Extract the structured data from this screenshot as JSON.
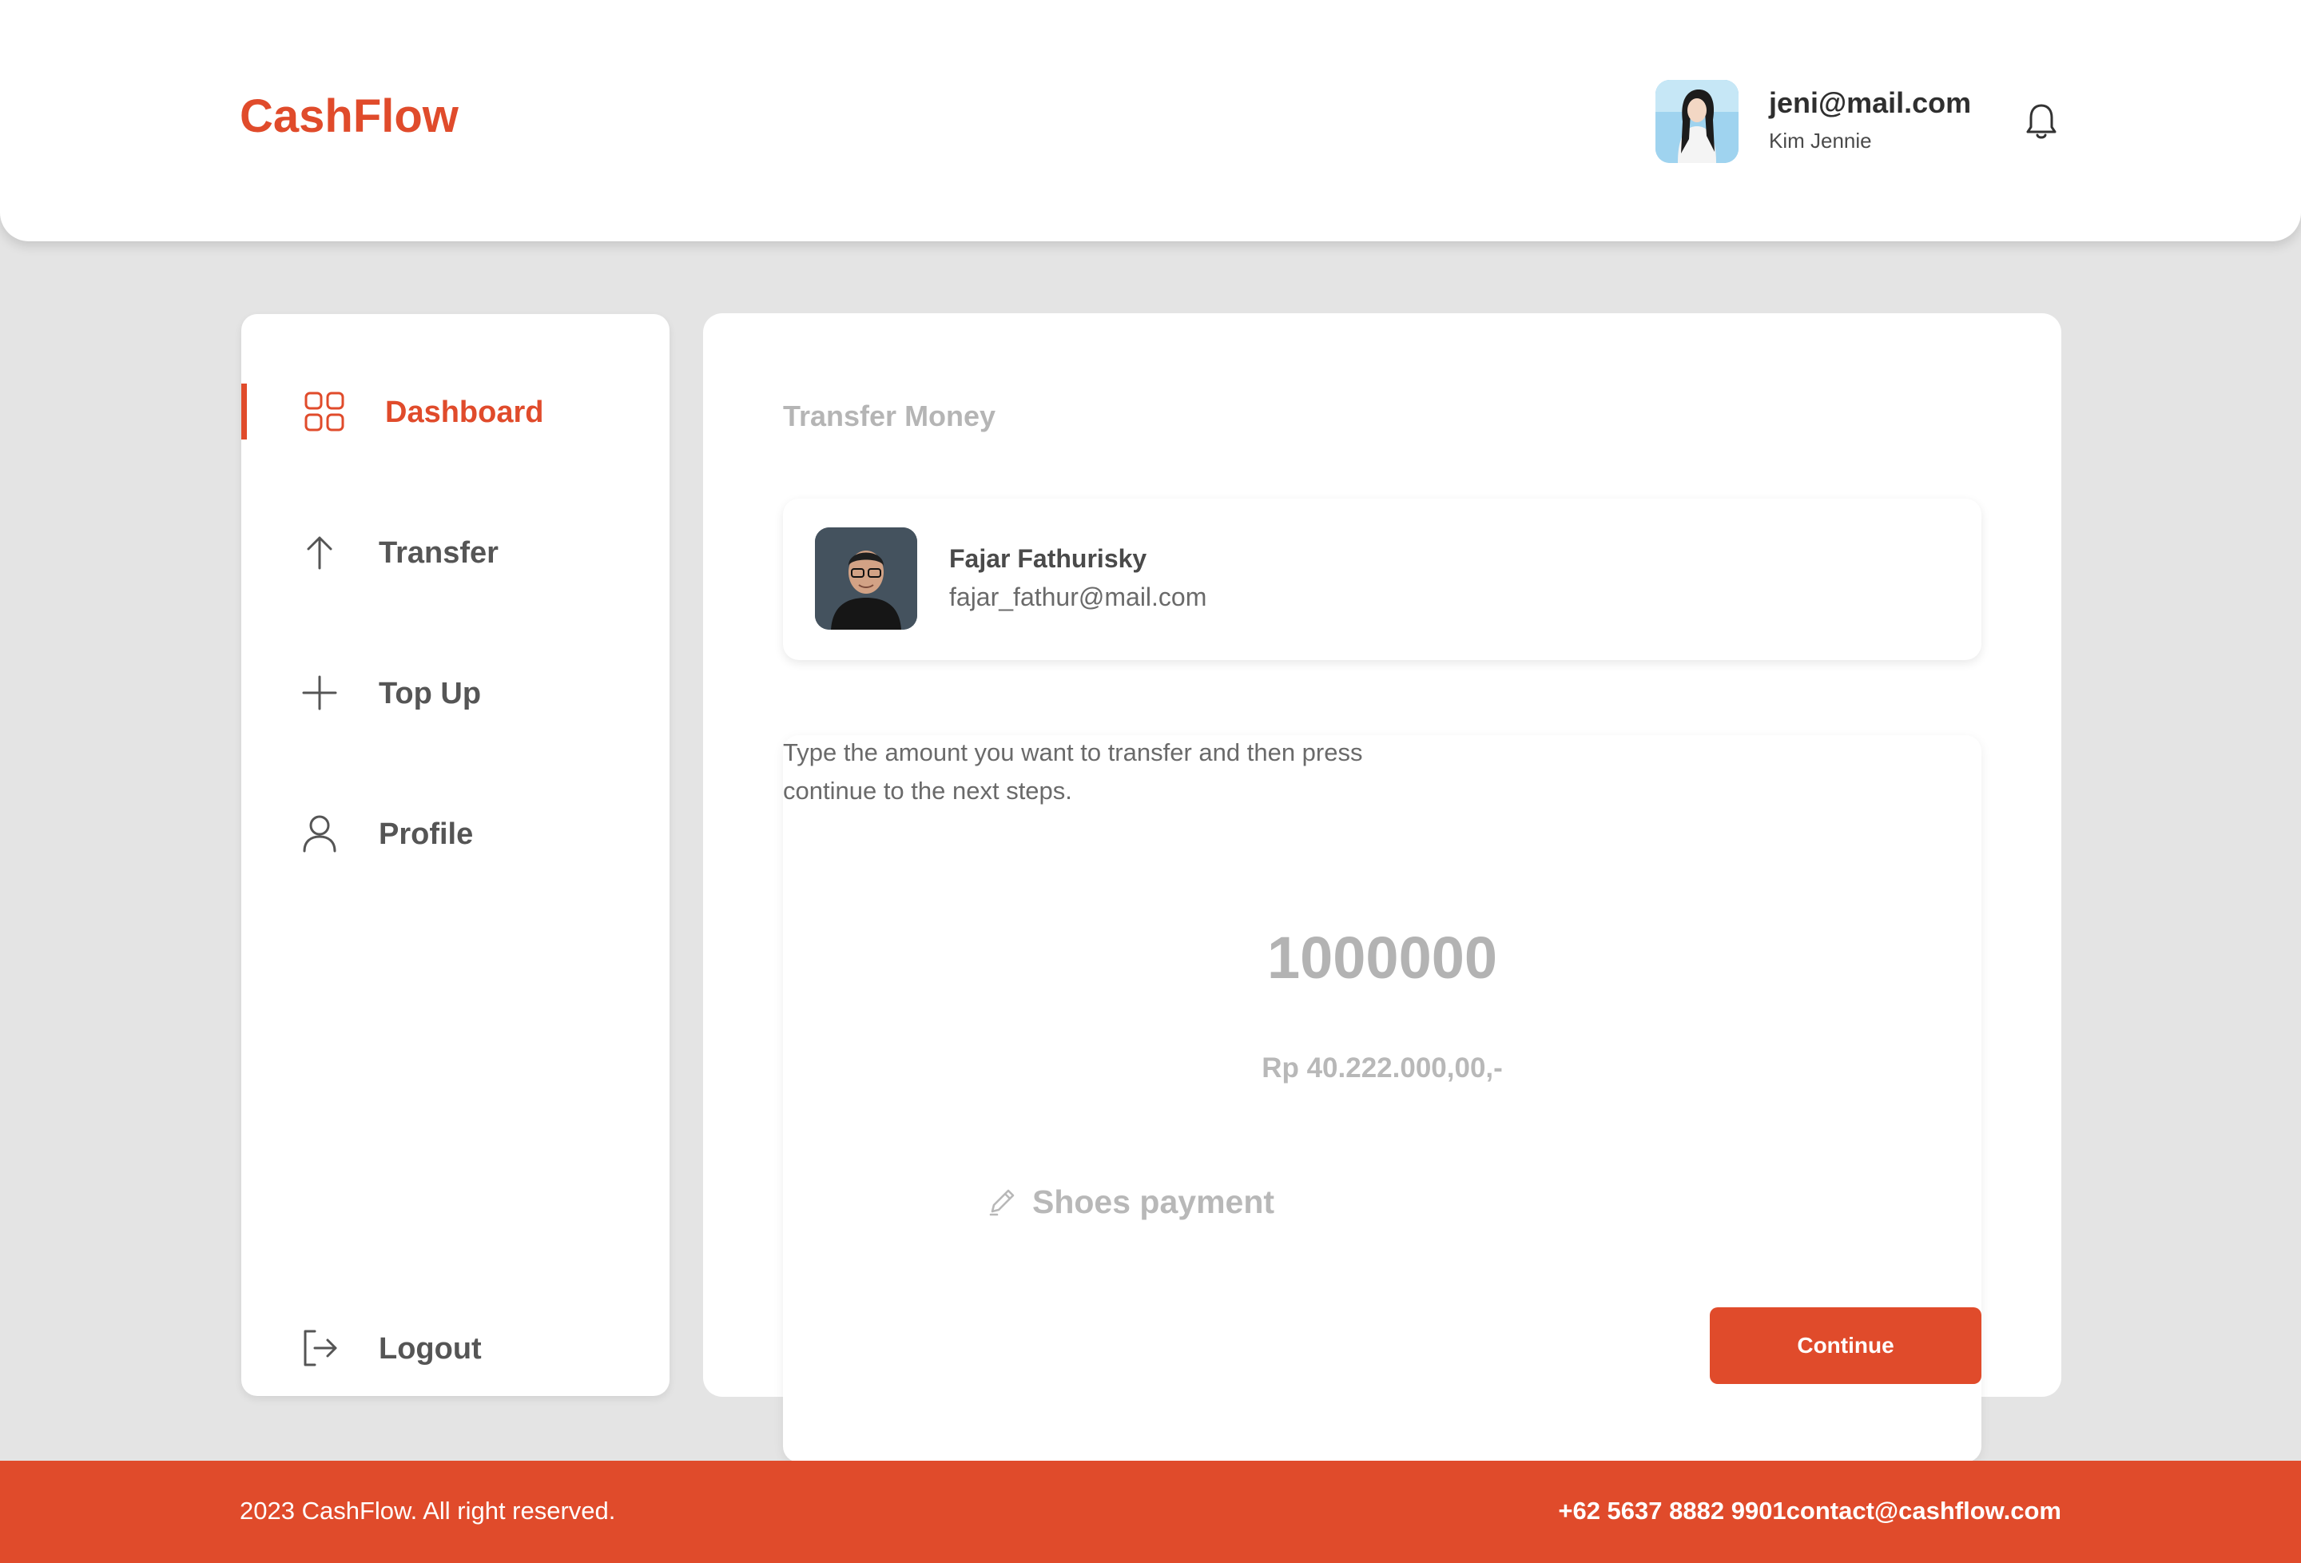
{
  "header": {
    "brand": "CashFlow",
    "user": {
      "email": "jeni@mail.com",
      "name": "Kim Jennie"
    }
  },
  "sidebar": {
    "items": [
      {
        "label": "Dashboard",
        "icon": "grid-icon",
        "active": true
      },
      {
        "label": "Transfer",
        "icon": "arrow-up-icon",
        "active": false
      },
      {
        "label": "Top Up",
        "icon": "plus-icon",
        "active": false
      },
      {
        "label": "Profile",
        "icon": "user-icon",
        "active": false
      }
    ],
    "logout": {
      "label": "Logout",
      "icon": "logout-icon"
    }
  },
  "main": {
    "title": "Transfer Money",
    "recipient": {
      "name": "Fajar Fathurisky",
      "email": "fajar_fathur@mail.com"
    },
    "instruction": "Type the amount you want to transfer and then press continue to the next steps.",
    "amount": "1000000",
    "balance": "Rp 40.222.000,00,-",
    "note": "Shoes payment",
    "continue_label": "Continue"
  },
  "footer": {
    "copyright": "2023 CashFlow. All right reserved.",
    "contact": "+62 5637 8882 9901contact@cashflow.com"
  },
  "colors": {
    "accent": "#e04b2b",
    "background": "#e4e4e4",
    "muted_text": "#b5b5b5"
  }
}
